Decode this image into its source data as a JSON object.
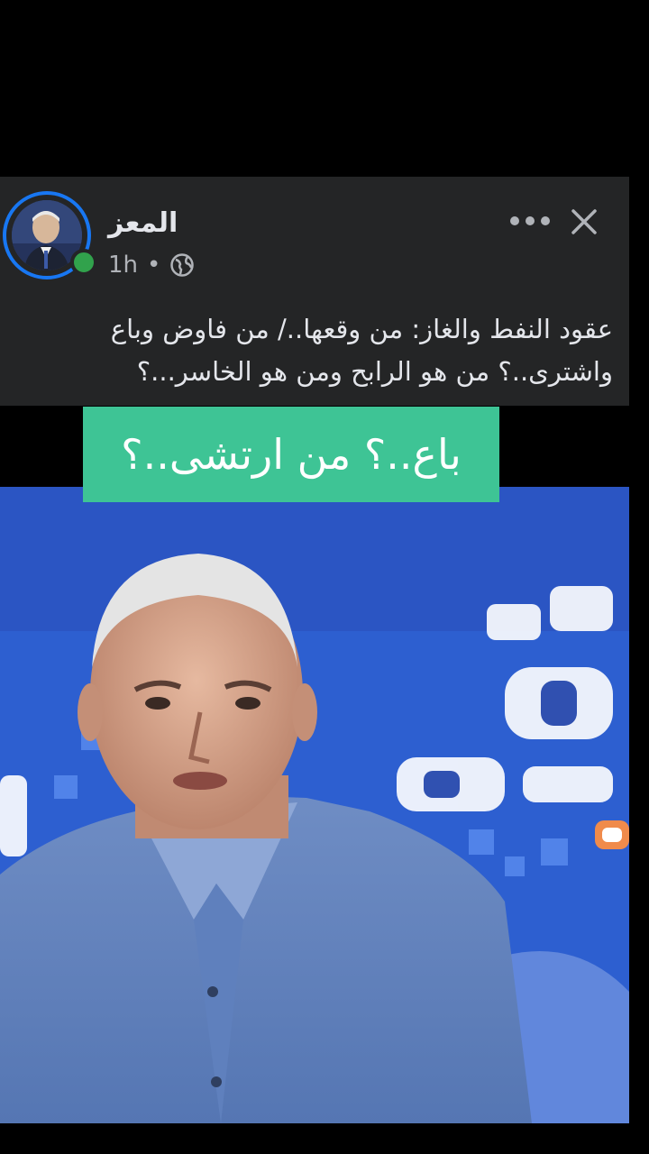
{
  "post": {
    "author_name": "المعز",
    "time_label": "1h",
    "separator": "•",
    "privacy_icon": "globe-icon",
    "text": "عقود النفط والغاز: من وقعها../ من فاوض وباع واشترى..؟ من هو الرابح ومن هو الخاسر...؟"
  },
  "header_actions": {
    "more_icon": "more-options-icon",
    "close_icon": "close-icon"
  },
  "video": {
    "caption": "باع..؟ من ارتشى..؟"
  },
  "colors": {
    "card_background": "#242526",
    "online_status": "#31a24c",
    "story_ring": "#1877f2",
    "caption_background": "#3ec495"
  }
}
